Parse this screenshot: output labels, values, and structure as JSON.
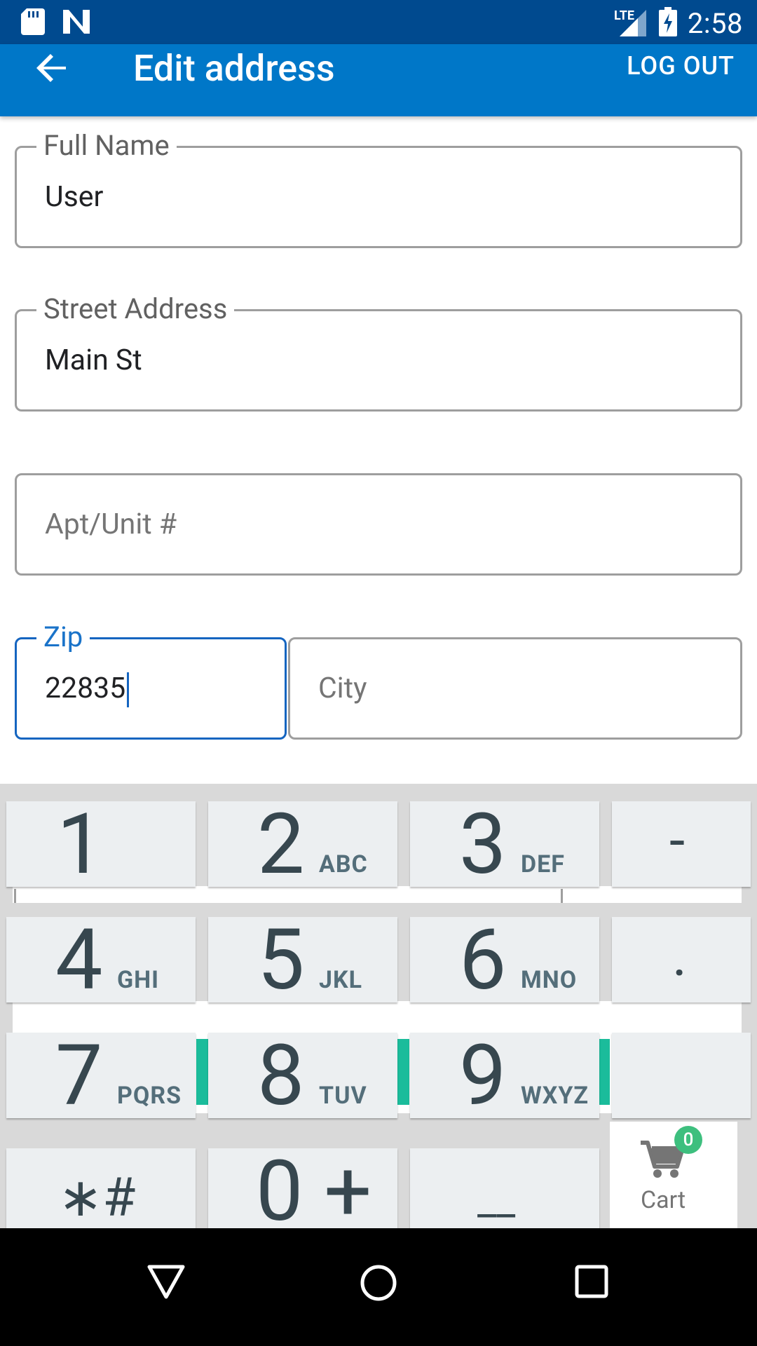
{
  "status_bar": {
    "time": "2:58",
    "network": "LTE",
    "icons": [
      "sd-card-icon",
      "n-notification-icon",
      "lte-signal-icon",
      "battery-charging-icon"
    ]
  },
  "app_bar": {
    "title": "Edit address",
    "logout_label": "LOG OUT",
    "back_icon": "arrow-left-icon"
  },
  "form": {
    "full_name": {
      "label": "Full Name",
      "value": "User"
    },
    "street_address": {
      "label": "Street Address",
      "value": "Main St"
    },
    "apt_unit": {
      "placeholder": "Apt/Unit #"
    },
    "zip": {
      "label": "Zip",
      "value": "22835"
    },
    "city": {
      "placeholder": "City"
    }
  },
  "keyboard": {
    "keys": [
      {
        "digit": "1",
        "letters": ""
      },
      {
        "digit": "2",
        "letters": "ABC"
      },
      {
        "digit": "3",
        "letters": "DEF"
      },
      {
        "digit": "-",
        "letters": ""
      },
      {
        "digit": "4",
        "letters": "GHI"
      },
      {
        "digit": "5",
        "letters": "JKL"
      },
      {
        "digit": "6",
        "letters": "MNO"
      },
      {
        "digit": ".",
        "letters": ""
      },
      {
        "digit": "7",
        "letters": "PQRS"
      },
      {
        "digit": "8",
        "letters": "TUV"
      },
      {
        "digit": "9",
        "letters": "WXYZ"
      },
      {
        "digit": "",
        "letters": ""
      },
      {
        "digit": "∗#",
        "letters": ""
      },
      {
        "digit": "0 +",
        "letters": ""
      },
      {
        "digit": "__",
        "letters": ""
      }
    ]
  },
  "cart": {
    "label": "Cart",
    "badge": "0",
    "icon": "shopping-cart-icon"
  },
  "nav_bar": {
    "icons": [
      "back-triangle-icon",
      "home-circle-icon",
      "recents-square-icon"
    ]
  },
  "colors": {
    "status_bar": "#004a8f",
    "app_bar": "#0077c8",
    "focus_blue": "#1565c0",
    "badge_green": "#3dbf7e",
    "teal_accent": "#1bbc9b"
  }
}
